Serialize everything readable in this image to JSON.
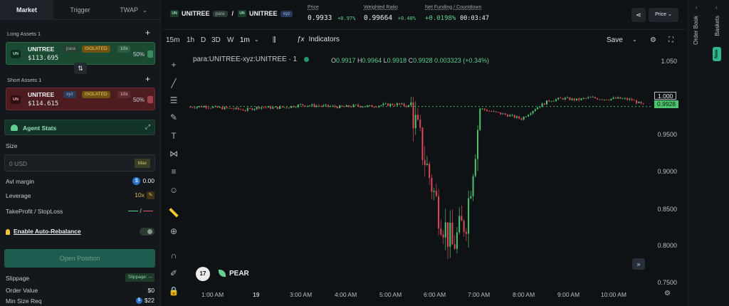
{
  "tabs": [
    {
      "label": "Market",
      "active": true
    },
    {
      "label": "Trigger",
      "active": false
    },
    {
      "label": "TWAP",
      "active": false
    }
  ],
  "long_assets": {
    "title": "Long Assets 1",
    "ticker_icon": "UN",
    "name": "UNITREE",
    "source": "para",
    "mode": "ISOLATED",
    "leverage": "10x",
    "price": "$113.695",
    "weight": "50%"
  },
  "short_assets": {
    "title": "Short Assets 1",
    "ticker_icon": "UN",
    "name": "UNITREE",
    "source": "xyz",
    "mode": "ISOLATED",
    "leverage": "10x",
    "price": "$114.615",
    "weight": "50%"
  },
  "agent_stats_label": "Agent Stats",
  "size": {
    "label": "Size",
    "value": "0 USD",
    "max_label": "Max"
  },
  "avl_margin": {
    "label": "Avl margin",
    "value": "0.00",
    "currency_icon": "$"
  },
  "leverage": {
    "label": "Leverage",
    "value": "10x"
  },
  "tpsl": {
    "label": "TakeProfit / StopLoss",
    "separator": "/"
  },
  "auto_rebalance_label": "Enable Auto-Rebalance",
  "open_position_label": "Open Position",
  "slippage": {
    "label": "Slippage",
    "button": "Slippage: --"
  },
  "order_value": {
    "label": "Order Value",
    "value": "$0"
  },
  "min_size": {
    "label": "Min Size Req",
    "value": "$22"
  },
  "header": {
    "pair_left_icon": "UN",
    "pair_left": "UNITREE",
    "pair_left_tag": "para",
    "pair_sep": "/",
    "pair_right_icon": "UN",
    "pair_right": "UNITREE",
    "pair_right_tag": "xyz",
    "price": {
      "label": "Price",
      "value": "0.9933",
      "change": "+0.97%"
    },
    "weighted_ratio": {
      "label": "Weighted Ratio",
      "value": "0.99664",
      "change": "+0.48%"
    },
    "net_funding": {
      "label": "Net Funding / Countdown",
      "value": "+0.0198%",
      "countdown": "00:03:47"
    },
    "price_dropdown": "Price"
  },
  "toolbar": {
    "timeframes": [
      "15m",
      "1h",
      "D",
      "3D",
      "W",
      "1m"
    ],
    "active_timeframe": "1m",
    "indicators_label": "Indicators",
    "save_label": "Save"
  },
  "chart_data": {
    "type": "candlestick",
    "symbol": "para:UNITREE-xyz:UNITREE · 1",
    "ohlc": {
      "open": "0.9917",
      "high": "0.9964",
      "low": "0.9918",
      "close": "0.9928",
      "change": "0.003323 (+0.34%)"
    },
    "ylim": [
      0.745,
      1.06
    ],
    "y_ticks": [
      "1.050",
      "1.000",
      "0.9500",
      "0.9000",
      "0.8500",
      "0.8000",
      "0.7500"
    ],
    "x_ticks": [
      "1:00 AM",
      "19",
      "3:00 AM",
      "4:00 AM",
      "5:00 AM",
      "6:00 AM",
      "7:00 AM",
      "8:00 AM",
      "9:00 AM",
      "10:00 AM"
    ],
    "current_price": "0.9928",
    "reference_price": "1.000",
    "colors": {
      "up": "#4cc46e",
      "down": "#e0485a"
    },
    "x": [
      0,
      20,
      40,
      60,
      80,
      100,
      120,
      140,
      160,
      180,
      200,
      220,
      240,
      260,
      280,
      300,
      320,
      340,
      360,
      380,
      400,
      420,
      440,
      460,
      480,
      500,
      520,
      540,
      560,
      580,
      600,
      620,
      640,
      660
    ],
    "y": [
      0.992,
      0.993,
      0.991,
      0.99,
      0.988,
      0.992,
      0.991,
      0.992,
      0.995,
      0.994,
      0.993,
      0.992,
      0.994,
      0.993,
      0.995,
      0.996,
      0.993,
      0.92,
      0.85,
      0.8,
      0.84,
      0.99,
      0.985,
      0.981,
      0.976,
      0.99,
      1.001,
      1.004,
      1.002,
      1.005,
      1.003,
      1.004,
      1.002,
      0.993
    ]
  },
  "brand": {
    "tv": "17",
    "pear": "PEAR"
  },
  "rail": {
    "order_book": "Order Book",
    "baskets": "Baskets",
    "new_badge": "New"
  }
}
